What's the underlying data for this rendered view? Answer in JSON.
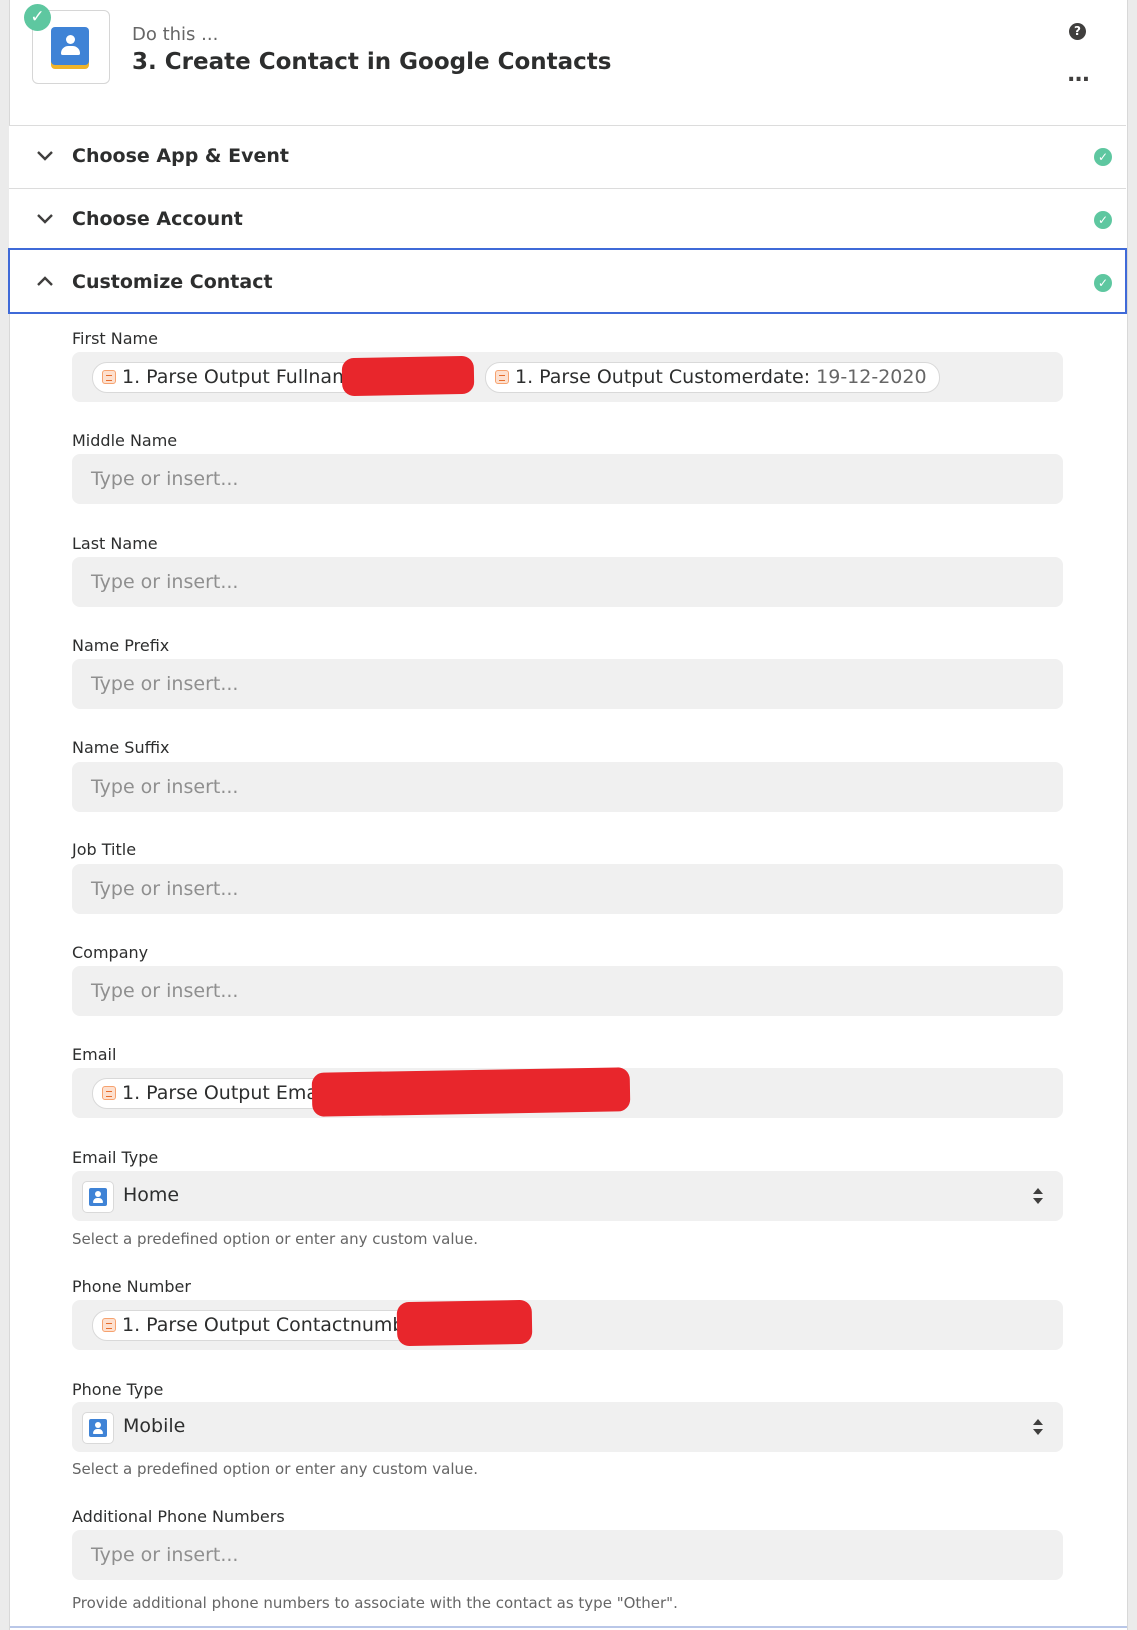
{
  "header": {
    "pre_title": "Do this ...",
    "title": "3. Create Contact in Google Contacts",
    "help_icon": "question-circle-icon",
    "more_label": "..."
  },
  "sections": [
    {
      "label": "Choose App & Event",
      "expanded": false,
      "complete": true
    },
    {
      "label": "Choose Account",
      "expanded": false,
      "complete": true
    },
    {
      "label": "Customize Contact",
      "expanded": true,
      "complete": true
    }
  ],
  "fields": {
    "first_name": {
      "label": "First Name",
      "tokens": [
        {
          "text": "1. Parse Output Fullname:",
          "value": ""
        },
        {
          "text": "1. Parse Output Customerdate:",
          "value": "19-12-2020"
        }
      ]
    },
    "middle_name": {
      "label": "Middle Name",
      "placeholder": "Type or insert..."
    },
    "last_name": {
      "label": "Last Name",
      "placeholder": "Type or insert..."
    },
    "name_prefix": {
      "label": "Name Prefix",
      "placeholder": "Type or insert..."
    },
    "name_suffix": {
      "label": "Name Suffix",
      "placeholder": "Type or insert..."
    },
    "job_title": {
      "label": "Job Title",
      "placeholder": "Type or insert..."
    },
    "company": {
      "label": "Company",
      "placeholder": "Type or insert..."
    },
    "email": {
      "label": "Email",
      "tokens": [
        {
          "text": "1. Parse Output Email:"
        }
      ]
    },
    "email_type": {
      "label": "Email Type",
      "value": "Home",
      "help": "Select a predefined option or enter any custom value."
    },
    "phone_number": {
      "label": "Phone Number",
      "tokens": [
        {
          "text": "1. Parse Output Contactnumber:"
        }
      ]
    },
    "phone_type": {
      "label": "Phone Type",
      "value": "Mobile",
      "help": "Select a predefined option or enter any custom value."
    },
    "additional_phones": {
      "label": "Additional Phone Numbers",
      "placeholder": "Type or insert...",
      "help": "Provide additional phone numbers to associate with the contact as type \"Other\"."
    }
  },
  "colors": {
    "accent": "#3f6ad8",
    "success": "#5ec7a0",
    "redaction": "#e8262c",
    "google_contacts": "#3f83d6"
  }
}
